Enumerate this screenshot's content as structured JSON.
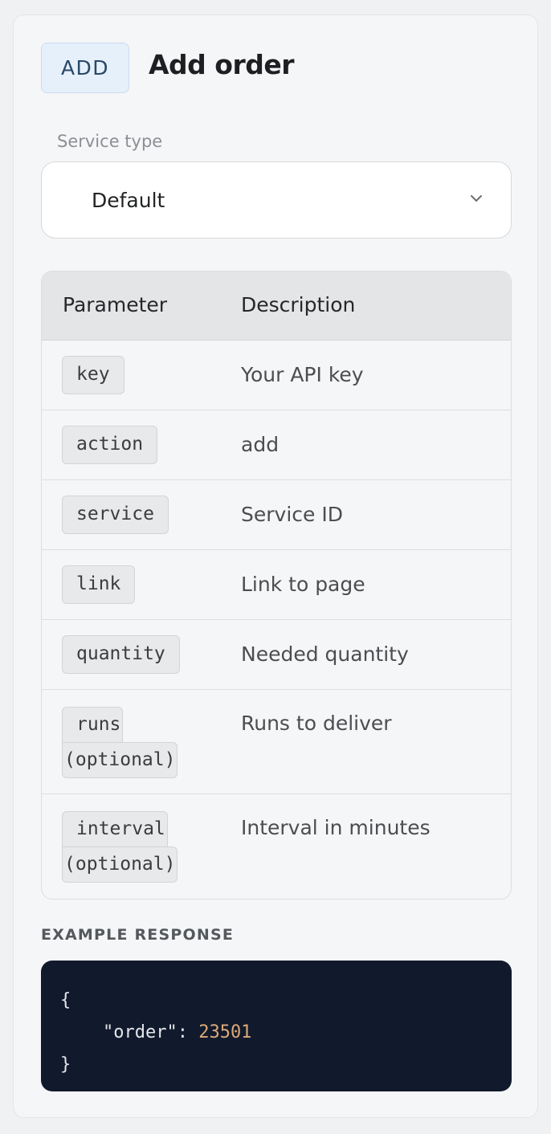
{
  "endpoint": {
    "method_badge": "ADD",
    "title": "Add order"
  },
  "service_type": {
    "label": "Service type",
    "selected": "Default"
  },
  "params_table": {
    "headers": [
      "Parameter",
      "Description"
    ],
    "rows": [
      {
        "param": "key",
        "optional": "",
        "description": "Your API key"
      },
      {
        "param": "action",
        "optional": "",
        "description": "add"
      },
      {
        "param": "service",
        "optional": "",
        "description": "Service ID"
      },
      {
        "param": "link",
        "optional": "",
        "description": "Link to page"
      },
      {
        "param": "quantity",
        "optional": "",
        "description": "Needed quantity"
      },
      {
        "param": "runs",
        "optional": "(optional)",
        "description": "Runs to deliver"
      },
      {
        "param": "interval",
        "optional": "(optional)",
        "description": "Interval in minutes"
      }
    ]
  },
  "example_response": {
    "label": "EXAMPLE RESPONSE",
    "open_brace": "{",
    "key": "\"order\"",
    "colon": ": ",
    "value": "23501",
    "close_brace": "}"
  }
}
